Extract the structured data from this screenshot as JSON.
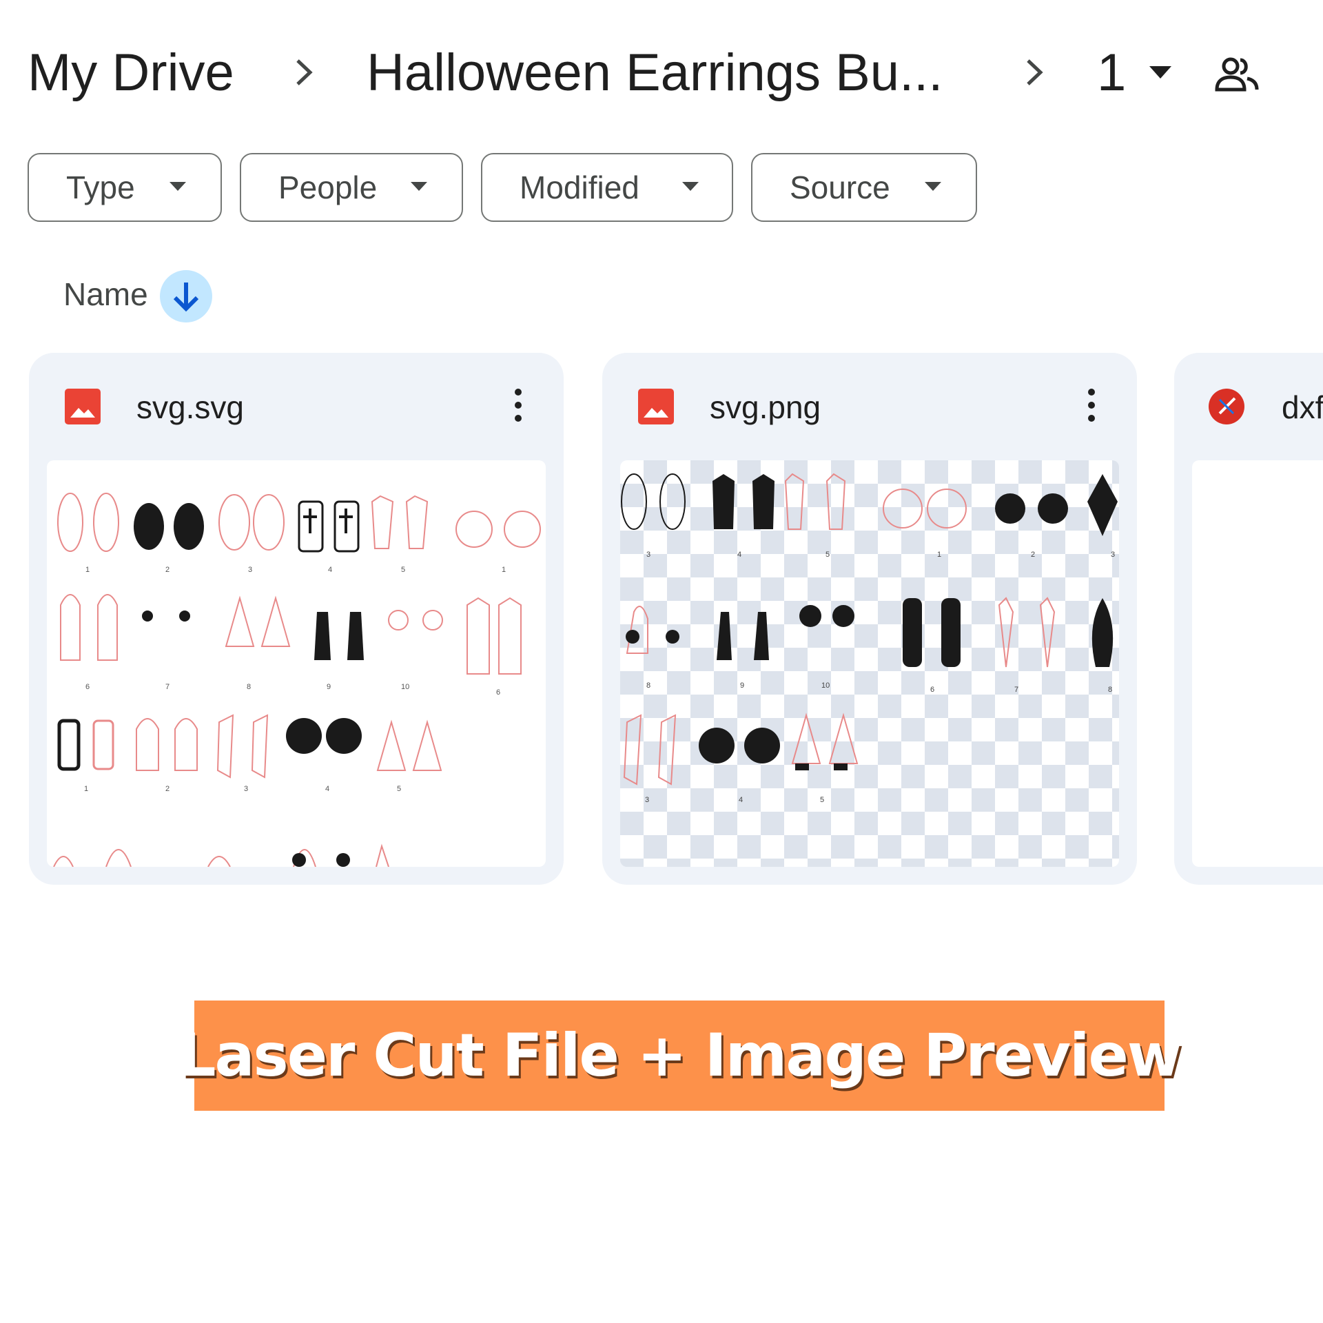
{
  "breadcrumb": {
    "root": "My Drive",
    "folder": "Halloween Earrings Bu...",
    "current": "1",
    "separator_icon": "chevron-right-icon",
    "share_icon": "people-icon"
  },
  "filters": {
    "type": "Type",
    "people": "People",
    "modified": "Modified",
    "source": "Source"
  },
  "sort": {
    "label": "Name",
    "direction_icon": "arrow-down-icon",
    "direction": "descending"
  },
  "files": [
    {
      "name": "svg.svg",
      "icon": "image-file-icon",
      "icon_color": "#ea4335",
      "thumbnail": "white"
    },
    {
      "name": "svg.png",
      "icon": "image-file-icon",
      "icon_color": "#ea4335",
      "thumbnail": "checkerboard"
    },
    {
      "name": "dxf",
      "icon": "unknown-file-icon",
      "icon_color": "#d93025",
      "thumbnail": "blank"
    }
  ],
  "thumbnail_svg_labels": {
    "row1": [
      "1",
      "2",
      "3",
      "4",
      "5",
      "1"
    ],
    "row2": [
      "6",
      "7",
      "8",
      "9",
      "10",
      "6"
    ],
    "row3": [
      "1",
      "2",
      "3",
      "4",
      "5"
    ]
  },
  "thumbnail_png_labels": {
    "row1": [
      "3",
      "4",
      "5",
      "1",
      "2",
      "3"
    ],
    "row2": [
      "8",
      "9",
      "10",
      "6",
      "7",
      "8"
    ],
    "row3": [
      "3",
      "4",
      "5"
    ]
  },
  "banner": {
    "text": "Laser Cut File + Image Preview",
    "background": "#fd914a"
  }
}
